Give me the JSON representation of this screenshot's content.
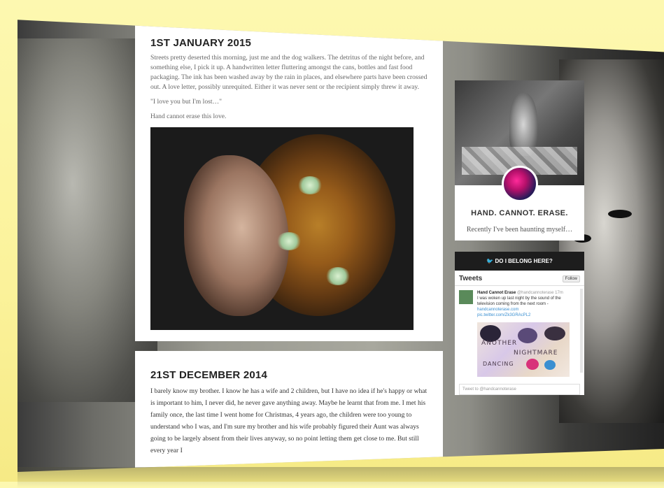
{
  "posts": [
    {
      "title": "1ST JANUARY 2015",
      "paragraphs": [
        "Streets pretty deserted this morning, just me and the dog walkers. The detritus of the night before, and something else, I pick it up. A handwritten letter fluttering amongst the cans, bottles and fast food packaging. The ink has been washed away by the rain in places, and elsewhere parts have been crossed out. A love letter, possibly unrequited.  Either it was never sent or the recipient simply threw it away.",
        "\"I love you but I'm lost…\"",
        "Hand cannot erase this love."
      ]
    },
    {
      "title": "21ST DECEMBER 2014",
      "paragraphs": [
        "I barely know my brother.  I know he has a wife and 2 children, but I have no idea if he's happy or what is important to him, I never did, he never gave anything away. Maybe he learnt that from me.  I met his family once, the last time I went home for Christmas, 4 years ago, the children were too young to understand who I was, and I'm sure my brother and his wife probably figured their Aunt was always going to be largely absent from their lives anyway, so no point letting them get close to me.  But still every year I"
      ]
    }
  ],
  "sidebar": {
    "blog_title": "HAND. CANNOT. ERASE.",
    "blog_description": "Recently I've been haunting myself…",
    "widget_header": "DO I BELONG HERE?",
    "tweets_label": "Tweets",
    "follow_label": "Follow",
    "tweet": {
      "name": "Hand Cannot Erase",
      "handle": "@handcannoterase",
      "time": "17m",
      "text": "I was woken up last night by the sound of the television coming from the next room - ",
      "link1": "handcannoterase.com",
      "link2": "pic.twitter.com/Zk3GRAcPL2",
      "image_text_1": "ANOTHER",
      "image_text_2": "NIGHTMARE",
      "image_text_3": "DANCING"
    },
    "tweet_input_placeholder": "Tweet to @handcannoterase"
  },
  "colors": {
    "page_background": "#fbf29a",
    "post_background": "#ffffff",
    "widget_header": "#1d1d1d",
    "link": "#3a8fd1"
  },
  "icons": [
    "twitter-bird-icon"
  ]
}
